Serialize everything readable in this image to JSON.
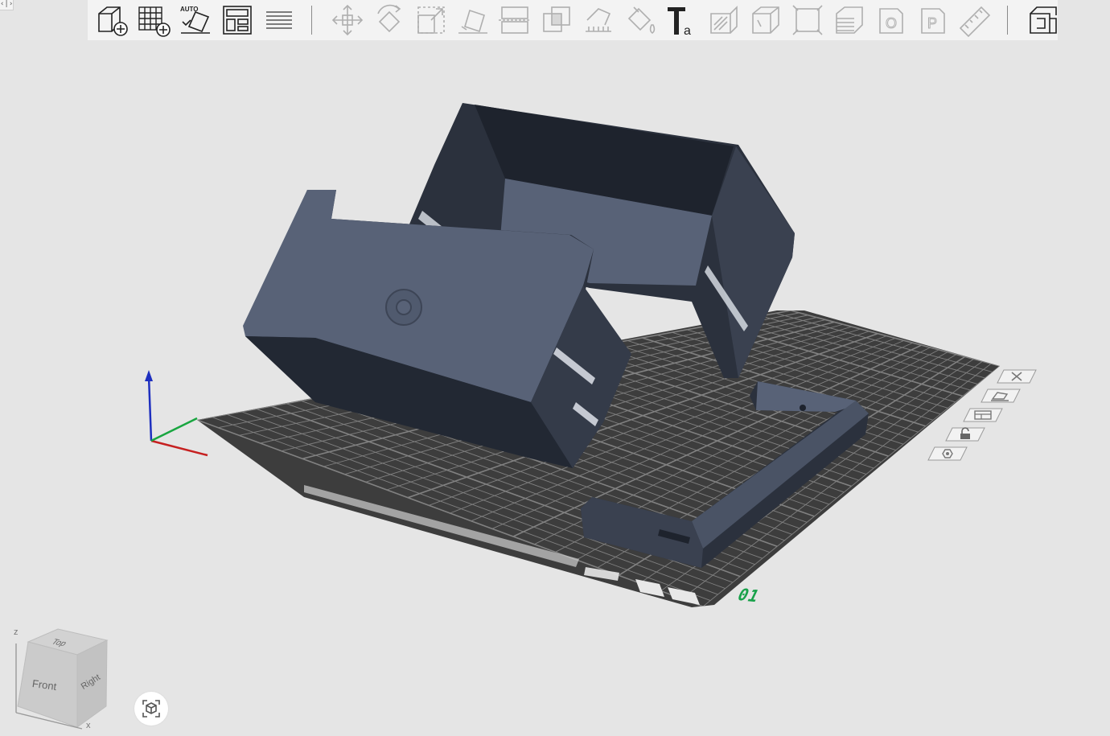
{
  "corner_handle": "‹|›",
  "toolbar": {
    "group_a": [
      {
        "name": "add-object-button",
        "icon": "cube-plus-icon",
        "disabled": false
      },
      {
        "name": "add-plate-button",
        "icon": "grid-plus-icon",
        "disabled": false
      },
      {
        "name": "auto-orient-button",
        "icon": "auto-orient-icon",
        "label": "AUTO",
        "disabled": false
      },
      {
        "name": "arrange-button",
        "icon": "arrange-layout-icon",
        "disabled": false
      },
      {
        "name": "split-layers-button",
        "icon": "layers-stack-icon",
        "disabled": false
      }
    ],
    "group_b": [
      {
        "name": "move-button",
        "icon": "move-arrows-icon",
        "disabled": true
      },
      {
        "name": "rotate-button",
        "icon": "rotate-icon",
        "disabled": true
      },
      {
        "name": "scale-button",
        "icon": "scale-icon",
        "disabled": true
      },
      {
        "name": "lay-on-face-button",
        "icon": "lay-on-face-icon",
        "disabled": true
      },
      {
        "name": "cut-button",
        "icon": "cut-plane-icon",
        "disabled": true
      },
      {
        "name": "boolean-button",
        "icon": "boolean-icon",
        "disabled": true
      },
      {
        "name": "support-paint-button",
        "icon": "support-paint-icon",
        "disabled": true
      },
      {
        "name": "color-paint-button",
        "icon": "paint-bucket-icon",
        "disabled": true
      },
      {
        "name": "text-button",
        "icon": "text-icon",
        "label": "Ta",
        "disabled": false
      },
      {
        "name": "seam-paint-button",
        "icon": "seam-icon",
        "disabled": true
      },
      {
        "name": "fuzzy-skin-button",
        "icon": "hollow-cube-icon",
        "disabled": true
      },
      {
        "name": "measure-button",
        "icon": "measure-frame-icon",
        "disabled": true
      },
      {
        "name": "variable-layer-button",
        "icon": "layer-height-icon",
        "disabled": true
      },
      {
        "name": "object-list-button",
        "icon": "o-letter-icon",
        "label": "O",
        "disabled": true
      },
      {
        "name": "plate-settings-button",
        "icon": "p-letter-icon",
        "label": "P",
        "disabled": true
      },
      {
        "name": "ruler-button",
        "icon": "ruler-icon",
        "disabled": true
      }
    ],
    "group_c": [
      {
        "name": "assembly-view-button",
        "icon": "assembly-icon",
        "disabled": false
      }
    ]
  },
  "plate": {
    "label": "01",
    "accent_color": "#18a14a"
  },
  "plate_side_tools": [
    {
      "name": "delete-plate-button",
      "icon": "close-icon"
    },
    {
      "name": "orient-plate-button",
      "icon": "orient-icon"
    },
    {
      "name": "arrange-plate-button",
      "icon": "arrange-plate-icon"
    },
    {
      "name": "lock-plate-button",
      "icon": "lock-icon"
    },
    {
      "name": "plate-settings-button",
      "icon": "settings-icon"
    }
  ],
  "view_cube": {
    "top": "Top",
    "front": "Front",
    "right": "Right",
    "axis_z": "z",
    "axis_x": "x"
  },
  "colors": {
    "model": "#586277",
    "model_dark": "#2b313d",
    "plate": "#3d3d3d",
    "grid": "#8d8d8d",
    "background": "#e5e5e5"
  }
}
